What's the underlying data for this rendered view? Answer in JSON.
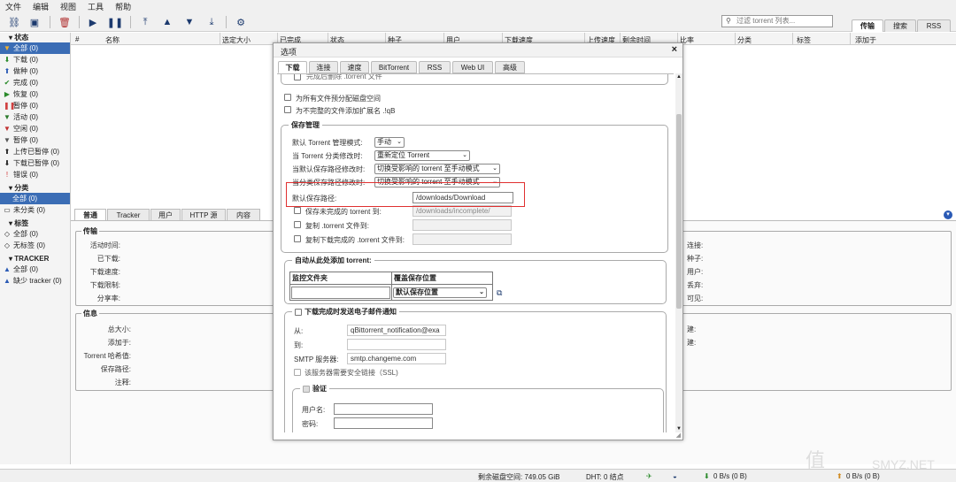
{
  "menu": [
    "文件",
    "编辑",
    "视图",
    "工具",
    "帮助"
  ],
  "toolbar": {
    "icons": [
      "add-link-icon",
      "add-file-icon",
      "delete-icon",
      "resume-icon",
      "pause-icon",
      "move-top-icon",
      "move-up-icon",
      "move-down-icon",
      "move-bottom-icon",
      "settings-icon"
    ],
    "filter_placeholder": "过滤 torrent 列表..."
  },
  "right_tabs": [
    "传输",
    "搜索",
    "RSS"
  ],
  "sidebar": {
    "status_header": "状态",
    "status_items": [
      {
        "label": "全部 (0)",
        "icon": "all-icon"
      },
      {
        "label": "下载 (0)",
        "icon": "download-icon"
      },
      {
        "label": "做种 (0)",
        "icon": "seed-icon"
      },
      {
        "label": "完成 (0)",
        "icon": "complete-icon"
      },
      {
        "label": "恢复 (0)",
        "icon": "resume-icon"
      },
      {
        "label": "暂停 (0)",
        "icon": "pause-icon"
      },
      {
        "label": "活动 (0)",
        "icon": "active-icon"
      },
      {
        "label": "空闲 (0)",
        "icon": "inactive-icon"
      },
      {
        "label": "暂停 (0)",
        "icon": "stalled-icon"
      },
      {
        "label": "上传已暂停 (0)",
        "icon": "upload-paused-icon"
      },
      {
        "label": "下载已暂停 (0)",
        "icon": "download-paused-icon"
      },
      {
        "label": "错误 (0)",
        "icon": "error-icon"
      }
    ],
    "category_header": "分类",
    "category_items": [
      "全部 (0)",
      "未分类 (0)"
    ],
    "tag_header": "标签",
    "tag_items": [
      "全部 (0)",
      "无标签 (0)"
    ],
    "tracker_header": "TRACKER",
    "tracker_items": [
      "全部 (0)",
      "缺少 tracker (0)"
    ]
  },
  "columns": [
    "#",
    "名称",
    "选定大小",
    "已完成",
    "状态",
    "种子",
    "用户",
    "下载速度",
    "上传速度",
    "剩余时间",
    "比率",
    "分类",
    "标签",
    "添加于"
  ],
  "bottom_tabs": [
    "普通",
    "Tracker",
    "用户",
    "HTTP 源",
    "内容"
  ],
  "bottom": {
    "transfer_legend": "传输",
    "transfer_labels": [
      "活动时间:",
      "已下载:",
      "下载速度:",
      "下载限制:",
      "分享率:"
    ],
    "transfer_right_labels": [
      "连接:",
      "种子:",
      "用户:",
      "丢弃:",
      "可见:"
    ],
    "info_legend": "信息",
    "info_labels": [
      "总大小:",
      "添加于:",
      "Torrent 哈希值:",
      "保存路径:",
      "注释:"
    ],
    "info_right_labels": [
      "建:",
      "建:"
    ]
  },
  "statusbar": {
    "disk": "剩余磁盘空间: 749.05 GiB",
    "dht": "DHT: 0 结点",
    "down": "0 B/s (0 B)",
    "up": "0 B/s (0 B)"
  },
  "watermark": "SMYZ.NET",
  "dialog": {
    "title": "选项",
    "tabs": [
      "下载",
      "连接",
      "速度",
      "BitTorrent",
      "RSS",
      "Web UI",
      "高级"
    ],
    "top_partial": "完成后删除 .torrent 文件",
    "prealloc": "为所有文件预分配磁盘空间",
    "append_ext": "为不完整的文件添加扩展名 .!qB",
    "save_legend": "保存管理",
    "mgmt_mode_label": "默认 Torrent 管理模式:",
    "mgmt_mode_value": "手动",
    "cat_change_label": "当 Torrent 分类修改时:",
    "cat_change_value": "重新定位 Torrent",
    "default_path_change_label": "当默认保存路径修改时:",
    "default_path_change_value": "切换受影响的 torrent 至手动模式",
    "cat_path_change_label": "当分类保存路径修改时:",
    "cat_path_change_value": "切换受影响的 torrent 至手动模式",
    "default_save_label": "默认保存路径:",
    "default_save_value": "/downloads/Download",
    "incomplete_label": "保存未完成的 torrent 到:",
    "incomplete_value": "/downloads/incomplete/",
    "copy_torrent_label": "复制 .torrent 文件到:",
    "copy_finished_label": "复制下载完成的 .torrent 文件到:",
    "auto_add_legend": "自动从此处添加 torrent:",
    "watch_col1": "监控文件夹",
    "watch_col2": "覆盖保存位置",
    "watch_select": "默认保存位置",
    "email_legend": "下载完成时发送电子邮件通知",
    "from_label": "从:",
    "from_value": "qBittorrent_notification@exa",
    "to_label": "到:",
    "smtp_label": "SMTP 服务器:",
    "smtp_value": "smtp.changeme.com",
    "ssl_label": "该服务器需要安全链接（SSL)",
    "auth_legend": "验证",
    "user_label": "用户名:",
    "pass_label": "密码:"
  }
}
